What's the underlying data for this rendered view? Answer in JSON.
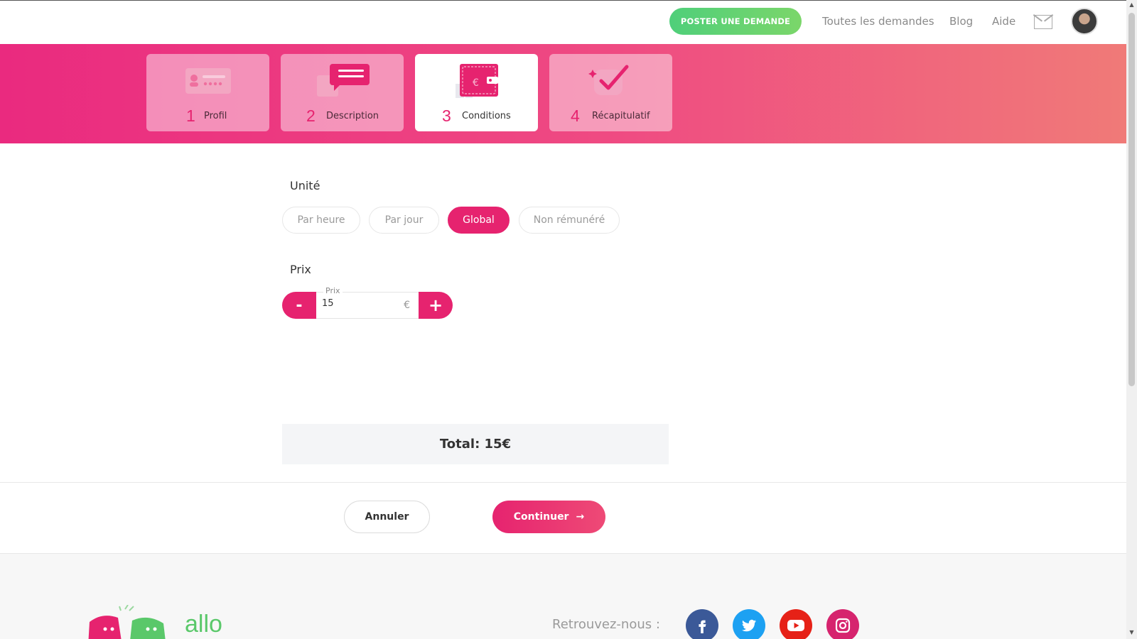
{
  "header": {
    "post_button": "POSTER UNE DEMANDE",
    "links": [
      "Toutes les demandes",
      "Blog",
      "Aide"
    ],
    "icons": [
      "mail-icon",
      "avatar"
    ]
  },
  "steps": [
    {
      "number": "1",
      "label": "Profil",
      "active": false
    },
    {
      "number": "2",
      "label": "Description",
      "active": false
    },
    {
      "number": "3",
      "label": "Conditions",
      "active": true
    },
    {
      "number": "4",
      "label": "Récapitulatif",
      "active": false
    }
  ],
  "form": {
    "unit_title": "Unité",
    "unit_options": [
      "Par heure",
      "Par jour",
      "Global",
      "Non rémunéré"
    ],
    "unit_selected": "Global",
    "price_title": "Prix",
    "price_field_label": "Prix",
    "price_value": "15",
    "price_unit": "€",
    "minus_label": "-",
    "plus_label": "+"
  },
  "total": "Total: 15€",
  "actions": {
    "cancel": "Annuler",
    "continue": "Continuer",
    "continue_arrow": "→"
  },
  "footer": {
    "logo_text": "allo",
    "follow_label": "Retrouvez-nous :",
    "social": [
      "facebook",
      "twitter",
      "youtube",
      "instagram"
    ]
  },
  "colors": {
    "accent": "#e6236f",
    "green": "#5ac86a",
    "facebook": "#3b5998",
    "twitter": "#1da1f2",
    "youtube": "#e62117",
    "instagram": "#d6246e"
  }
}
